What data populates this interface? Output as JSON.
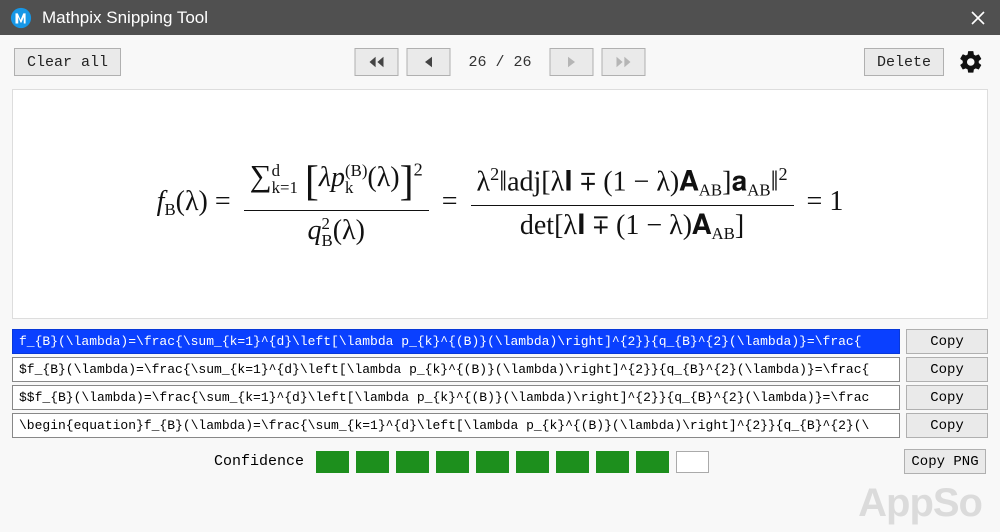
{
  "window": {
    "title": "Mathpix Snipping Tool"
  },
  "toolbar": {
    "clear_all": "Clear all",
    "page_indicator": "26 / 26",
    "delete": "Delete"
  },
  "equation": {
    "lhs": "f",
    "lhs_sub": "B",
    "lhs_arg": "(λ) = ",
    "num1_sum_top": "d",
    "num1_sum_bot": "k=1",
    "num1_body": "λp",
    "num1_body_subsup_top": "(B)",
    "num1_body_subsup_bot": "k",
    "num1_body_arg": "(λ)",
    "num1_outer_sup": "2",
    "den1": "q",
    "den1_sup": "2",
    "den1_sub": "B",
    "den1_arg": "(λ)",
    "eq1": " = ",
    "num2_pre": "λ",
    "num2_pre_sup": "2",
    "num2_mid": "‖adj[λ𝐈 ∓ (1 − λ)𝐀",
    "num2_mid_sub": "AB",
    "num2_mid2": "]𝐚",
    "num2_mid2_sub": "AB",
    "num2_end": "‖",
    "num2_end_sup": "2",
    "den2_pre": "det[λ𝐈 ∓ (1 − λ)𝐀",
    "den2_sub": "AB",
    "den2_end": "]",
    "eq2": " = 1"
  },
  "latex": {
    "row1": "f_{B}(\\lambda)=\\frac{\\sum_{k=1}^{d}\\left[\\lambda p_{k}^{(B)}(\\lambda)\\right]^{2}}{q_{B}^{2}(\\lambda)}=\\frac{",
    "row2": "$f_{B}(\\lambda)=\\frac{\\sum_{k=1}^{d}\\left[\\lambda p_{k}^{(B)}(\\lambda)\\right]^{2}}{q_{B}^{2}(\\lambda)}=\\frac{",
    "row3": "$$f_{B}(\\lambda)=\\frac{\\sum_{k=1}^{d}\\left[\\lambda p_{k}^{(B)}(\\lambda)\\right]^{2}}{q_{B}^{2}(\\lambda)}=\\frac",
    "row4": "\\begin{equation}f_{B}(\\lambda)=\\frac{\\sum_{k=1}^{d}\\left[\\lambda p_{k}^{(B)}(\\lambda)\\right]^{2}}{q_{B}^{2}(\\",
    "copy": "Copy"
  },
  "footer": {
    "confidence_label": "Confidence",
    "copy_png": "Copy PNG"
  },
  "watermark": "AppSo"
}
